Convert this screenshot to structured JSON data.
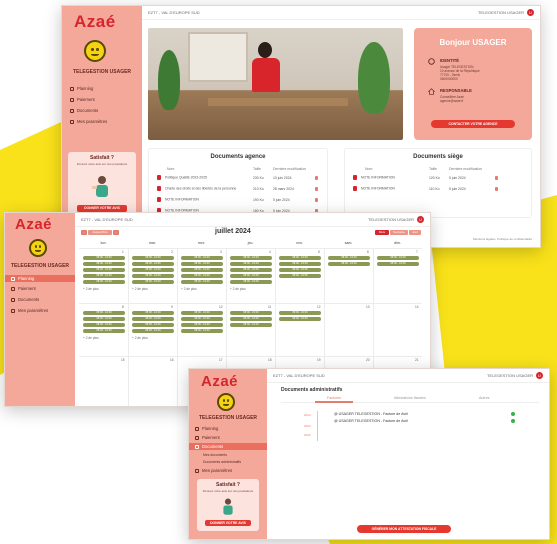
{
  "brand": {
    "logo": "Azaé",
    "user_name": "TELEGESTION USAGER",
    "accent": "#d6262d",
    "sidebar_bg": "#f4a89a",
    "event_color": "#8a9a54",
    "highlight": "#f9e21a"
  },
  "nav": [
    {
      "label": "Planning",
      "icon": "calendar-icon"
    },
    {
      "label": "Paiement",
      "icon": "card-icon"
    },
    {
      "label": "Documents",
      "icon": "document-icon"
    },
    {
      "label": "Mes paramètres",
      "icon": "gear-icon"
    }
  ],
  "nav_sub": [
    "Mes documents",
    "Documents administratifs"
  ],
  "topbar": {
    "breadcrumb": "EZT7 - VAL D'EUROPE SUD",
    "user_menu": "TELEGESTION USAGER",
    "avatar": "U"
  },
  "promo": {
    "title": "Satisfait ?",
    "text": "Donnez votre avis sur nos prestations",
    "button": "DONNER VOTRE AVIS"
  },
  "dashboard": {
    "greeting": "Bonjour USAGER",
    "identity_label": "IDENTITÉ",
    "identity_lines": [
      "Usager TELEGESTION",
      "10 avenue de la République",
      "77700 - Serris",
      "0600000000"
    ],
    "manager_label": "RESPONSABLE",
    "manager_lines": [
      "Conseillère Azaé",
      "agence@azae.fr"
    ],
    "contact_button": "CONTACTER VOTRE AGENCE",
    "agency_docs": {
      "title": "Documents agence",
      "headers": [
        "Nom",
        "Taille",
        "Dernière modification"
      ],
      "rows": [
        {
          "name": "Politique Qualité 2023-2025",
          "size": "230 Ko",
          "date": "10 juin 2024"
        },
        {
          "name": "Charte des droits et des libertés de la personne",
          "size": "210 Ko",
          "date": "28 mars 2024"
        },
        {
          "name": "NOTE INFORMATION",
          "size": "190 Ko",
          "date": "5 juin 2024"
        },
        {
          "name": "NOTE INFORMATION",
          "size": "180 Ko",
          "date": "5 juin 2024"
        }
      ]
    },
    "siege_docs": {
      "title": "Documents siège",
      "headers": [
        "Nom",
        "Taille",
        "Dernière modification"
      ],
      "rows": [
        {
          "name": "NOTE INFORMATION",
          "size": "120 Ko",
          "date": "5 juin 2024"
        },
        {
          "name": "NOTE INFORMATION",
          "size": "110 Ko",
          "date": "5 juin 2024"
        }
      ]
    },
    "footer_links": [
      "Mentions légales",
      "Politique de confidentialité"
    ]
  },
  "calendar": {
    "month": "juillet 2024",
    "today_button": "Aujourd'hui",
    "view_buttons": [
      "Mois",
      "Semaine",
      "Jour"
    ],
    "weekdays": [
      "lun.",
      "mar.",
      "mer.",
      "jeu.",
      "ven.",
      "sam.",
      "dim."
    ],
    "week1_days": [
      "1",
      "2",
      "3",
      "4",
      "5",
      "6",
      "7"
    ],
    "week2_days": [
      "8",
      "9",
      "10",
      "11",
      "12",
      "13",
      "14"
    ],
    "week3_days": [
      "15",
      "16",
      "17",
      "18",
      "19",
      "20",
      "21"
    ],
    "event_label": "08:00 - 10:00",
    "more": "+ 2 de plus"
  },
  "documents": {
    "title": "Documents administratifs",
    "tabs": [
      "Factures",
      "Attestations fiscales",
      "Autres"
    ],
    "years": [
      "2024",
      "2023",
      "2022"
    ],
    "rows": [
      {
        "name": "USAGER TELEGESTION - Facture de Avril"
      },
      {
        "name": "USAGER TELEGESTION - Facture de Avril"
      }
    ],
    "button": "GÉNÉRER MON ATTESTATION FISCALE"
  }
}
